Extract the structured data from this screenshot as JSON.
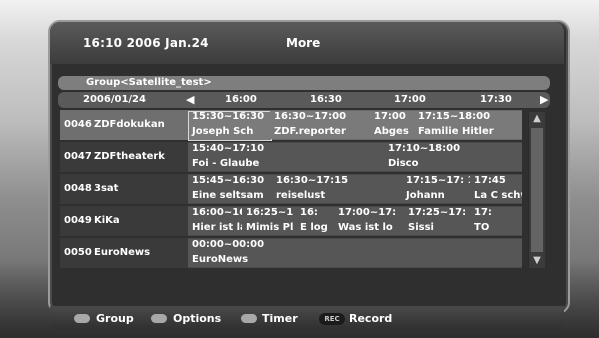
{
  "header": {
    "datetime": "16:10 2006 Jan.24",
    "title": "More"
  },
  "group": {
    "label": "Group<Satellite_test>"
  },
  "timebar": {
    "date": "2006/01/24",
    "times": [
      "16:00",
      "16:30",
      "17:00",
      "17:30"
    ],
    "left_icon": "arrow-left-icon",
    "right_icon": "arrow-right-icon"
  },
  "channels": [
    {
      "number": "0046",
      "name": "ZDFdokukan",
      "programs": [
        {
          "time": "15:30~16:30",
          "title": "Joseph Sch",
          "focused": true
        },
        {
          "time": "16:30~17:00",
          "title": "ZDF.reporter"
        },
        {
          "time": "17:00",
          "title": "Abges"
        },
        {
          "time": "17:15~18:00",
          "title": "Familie Hitler"
        }
      ]
    },
    {
      "number": "0047",
      "name": "ZDFtheaterk",
      "programs": [
        {
          "time": "15:40~17:10",
          "title": "Foi - Glaube"
        },
        {
          "time": "17:10~18:00",
          "title": "Disco"
        }
      ]
    },
    {
      "number": "0048",
      "name": "3sat",
      "programs": [
        {
          "time": "15:45~16:30",
          "title": "Eine seltsam"
        },
        {
          "time": "16:30~17:15",
          "title": "reiselust"
        },
        {
          "time": "17:15~17: 1",
          "title": "Johann"
        },
        {
          "time": "17:45",
          "title": "La C schw"
        }
      ]
    },
    {
      "number": "0049",
      "name": "KiKa",
      "programs": [
        {
          "time": "16:00~16:",
          "title": "Hier ist la"
        },
        {
          "time": "16:25~1 1",
          "title": "Mimis Pl"
        },
        {
          "time": "16:",
          "title": "E log"
        },
        {
          "time": "17:00~17:",
          "title": "Was ist lo"
        },
        {
          "time": "17:25~17:",
          "title": "Sissi"
        },
        {
          "time": "17:",
          "title": "TO"
        }
      ]
    },
    {
      "number": "0050",
      "name": "EuroNews",
      "programs": [
        {
          "time": "00:00~00:00",
          "title": "EuroNews"
        }
      ]
    }
  ],
  "footer": {
    "keys": [
      {
        "label": "Group",
        "icon": "green-key-icon"
      },
      {
        "label": "Options",
        "icon": "yellow-key-icon"
      },
      {
        "label": "Timer",
        "icon": "blue-key-icon"
      },
      {
        "label": "Record",
        "icon": "rec-key-icon",
        "badge": "REC"
      }
    ]
  },
  "colors": {
    "window": "#2f2f2f",
    "row": "#4a4a4a",
    "selected_row": "#6a6a6a",
    "accent_border": "#d9d9d9"
  }
}
